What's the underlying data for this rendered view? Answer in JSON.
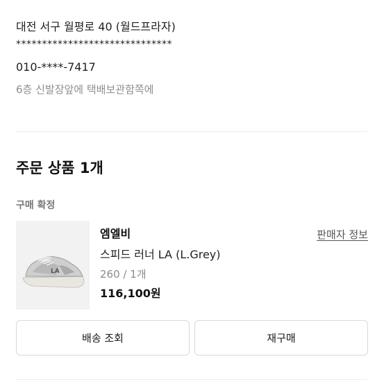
{
  "shipping": {
    "address_line": "대전 서구 월평로 40 (월드프라자)",
    "address_detail_masked": "******************************",
    "phone": "010-****-7417",
    "memo": "6층 신발장앞에 택배보관함쪽에"
  },
  "order_items": {
    "title": "주문 상품 1개",
    "status": "구매 확정",
    "product": {
      "image_icon": "sneaker-image",
      "brand": "엠엘비",
      "name": "스피드 러너 LA (L.Grey)",
      "option": "260 / 1개",
      "price": "116,100원",
      "seller_info_label": "판매자 정보"
    },
    "buttons": {
      "track_label": "배송 조회",
      "rebuy_label": "재구매"
    }
  },
  "colors": {
    "text": "#1b1b1b",
    "muted": "#8e8e8e",
    "border": "#d9d9d9",
    "divider": "#ececec"
  }
}
